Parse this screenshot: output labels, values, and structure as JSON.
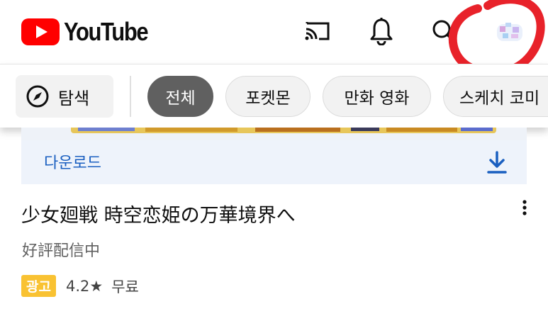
{
  "topbar": {
    "logo_text": "YouTube",
    "brand_color": "#ff0000",
    "icons": [
      "cast-icon",
      "bell-icon",
      "search-icon",
      "avatar"
    ]
  },
  "chips": {
    "explore_label": "탐색",
    "items": [
      {
        "label": "전체",
        "selected": true
      },
      {
        "label": "포켓몬",
        "selected": false
      },
      {
        "label": "만화 영화",
        "selected": false
      },
      {
        "label": "스케치 코미",
        "selected": false
      }
    ]
  },
  "ad": {
    "download_label": "다운로드",
    "title": "少女廻戦 時空恋姫の万華境界へ",
    "subtitle": "好評配信中",
    "badge": "광고",
    "rating": "4.2★",
    "price": "무료",
    "badge_color": "#f9c232",
    "link_color": "#1a5fc0"
  },
  "annotation": {
    "color": "#e8222a",
    "shape": "hand-drawn circle around avatar"
  }
}
